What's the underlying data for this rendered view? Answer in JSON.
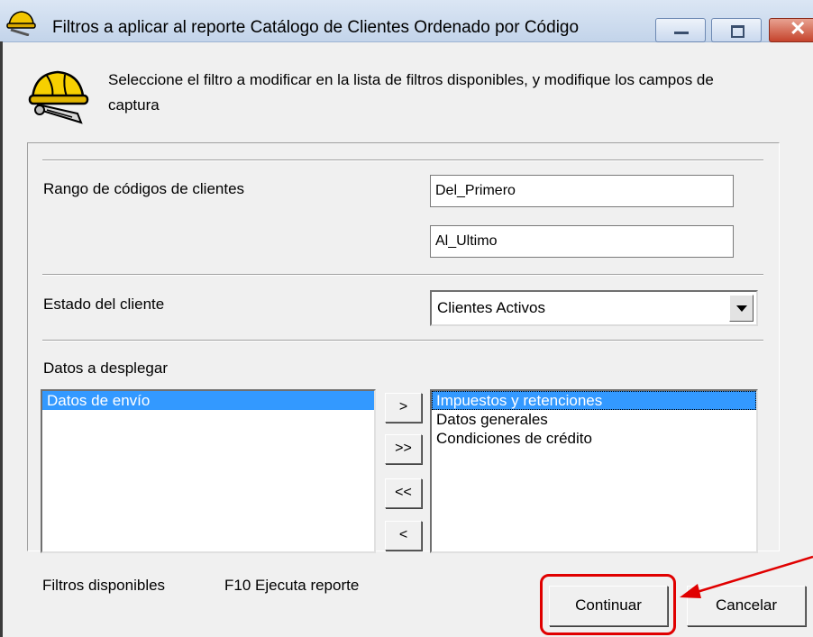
{
  "window": {
    "title": "Filtros a aplicar al reporte Catálogo de Clientes Ordenado por Código"
  },
  "header": {
    "instructions": "Seleccione el filtro a modificar  en la lista de filtros disponibles, y modifique los campos de  captura"
  },
  "filters": {
    "range_label": "Rango de códigos de clientes",
    "range_from": "Del_Primero",
    "range_to": "Al_Ultimo",
    "status_label": "Estado del cliente",
    "status_selected": "Clientes Activos",
    "display_label": "Datos a desplegar",
    "available_items": [
      "Datos de envío"
    ],
    "selected_items": [
      "Impuestos y retenciones",
      "Datos generales",
      "Condiciones de crédito"
    ],
    "move_buttons": {
      "add_one": ">",
      "add_all": ">>",
      "remove_all": "<<",
      "remove_one": "<"
    }
  },
  "footer": {
    "available_filters": "Filtros disponibles",
    "hint": "F10 Ejecuta reporte",
    "continue_label": "Continuar",
    "cancel_label": "Cancelar"
  },
  "colors": {
    "selection": "#3399ff",
    "annotation": "#e00000"
  }
}
